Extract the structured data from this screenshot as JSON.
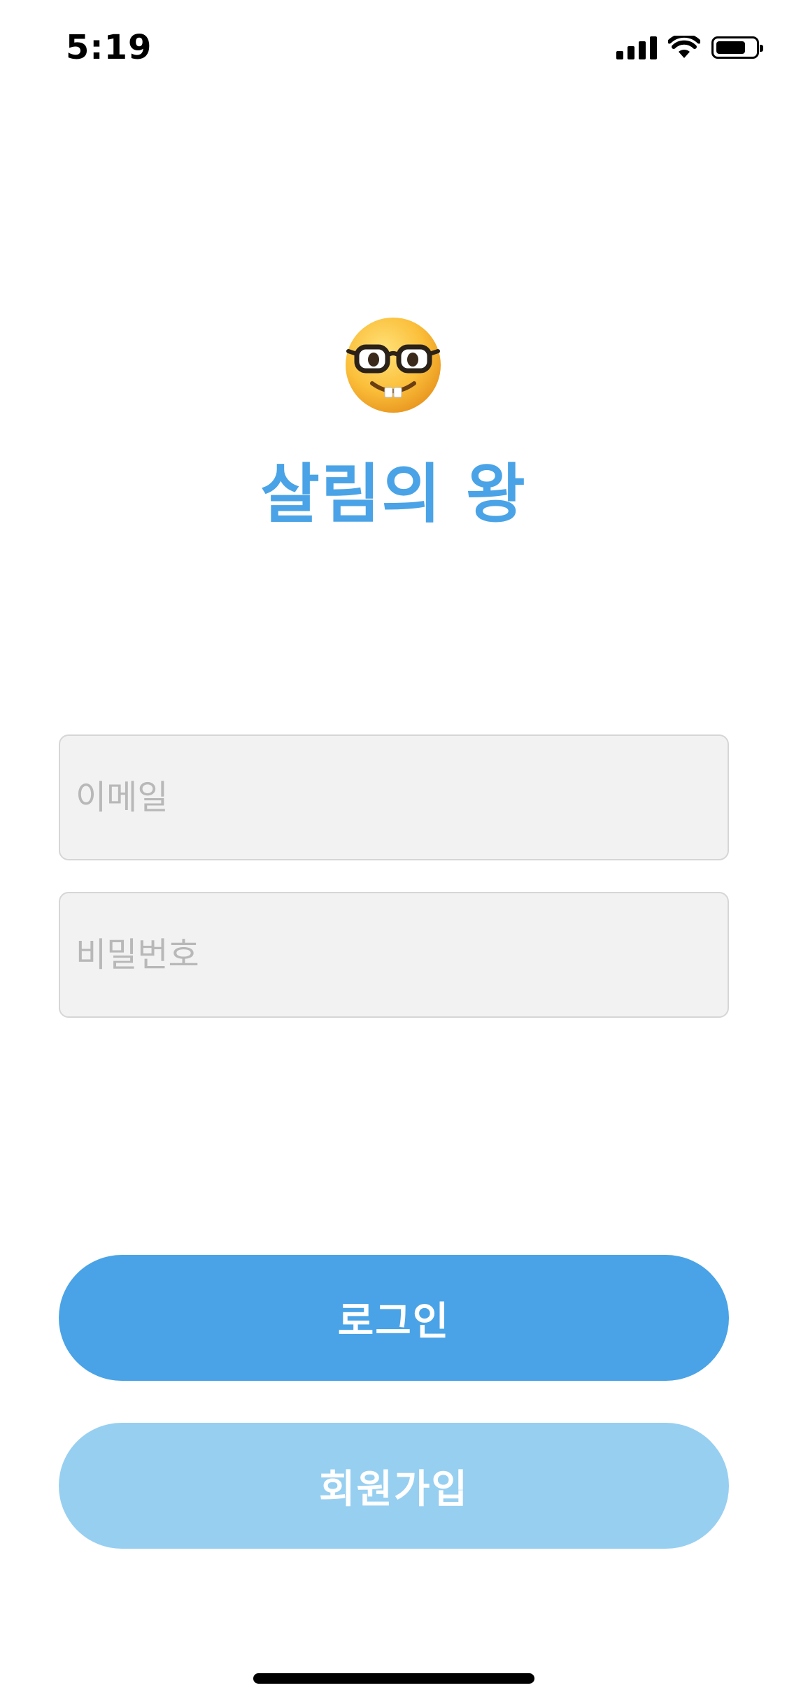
{
  "status_bar": {
    "time": "5:19",
    "signal_icon": "cellular-signal-icon",
    "wifi_icon": "wifi-icon",
    "battery_icon": "battery-icon",
    "battery_level": 0.75
  },
  "header": {
    "logo_icon": "nerd-face-emoji-icon",
    "app_title": "살림의 왕"
  },
  "form": {
    "email": {
      "placeholder": "이메일",
      "value": ""
    },
    "password": {
      "placeholder": "비밀번호",
      "value": ""
    }
  },
  "actions": {
    "login_label": "로그인",
    "signup_label": "회원가입"
  },
  "colors": {
    "primary": "#49a3e6",
    "primary_light": "#97cff1",
    "field_background": "#f2f2f2",
    "placeholder": "#b8b8b8"
  }
}
